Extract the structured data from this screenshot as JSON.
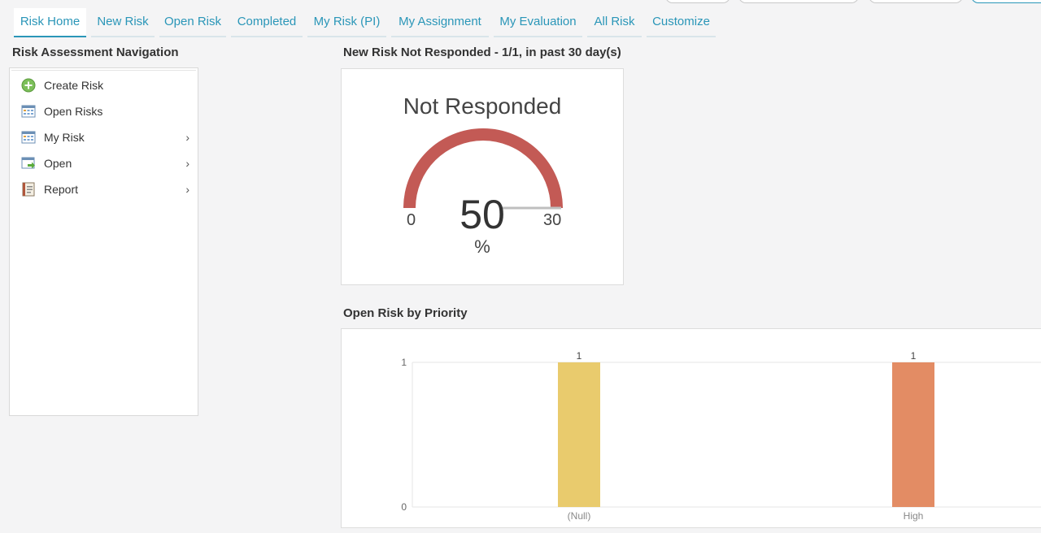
{
  "tabs": [
    {
      "label": "Risk Home",
      "active": true
    },
    {
      "label": "New Risk"
    },
    {
      "label": "Open Risk"
    },
    {
      "label": "Completed"
    },
    {
      "label": "My Risk (PI)"
    },
    {
      "label": "My Assignment"
    },
    {
      "label": "My Evaluation"
    },
    {
      "label": "All Risk"
    },
    {
      "label": "Customize"
    }
  ],
  "sidebar": {
    "title": "Risk Assessment Navigation",
    "items": [
      {
        "label": "Create Risk",
        "icon": "plus-circle-icon"
      },
      {
        "label": "Open Risks",
        "icon": "grid-table-icon"
      },
      {
        "label": "My Risk",
        "icon": "grid-table-icon",
        "submenu": true
      },
      {
        "label": "Open",
        "icon": "window-arrow-icon",
        "submenu": true
      },
      {
        "label": "Report",
        "icon": "report-book-icon",
        "submenu": true
      }
    ],
    "chevron": "›"
  },
  "gauge": {
    "panel_title": "New Risk Not Responded - 1/1, in past 30 day(s)",
    "title": "Not Responded",
    "value": "50",
    "unit": "%",
    "min": "0",
    "max": "30",
    "fill_fraction": 1.0,
    "color": "#c35a55"
  },
  "priority": {
    "panel_title": "Open Risk by Priority"
  },
  "chart_data": {
    "type": "bar",
    "categories": [
      "(Null)",
      "High"
    ],
    "values": [
      1,
      1
    ],
    "data_labels": [
      "1",
      "1"
    ],
    "colors": [
      "#e9cb6d",
      "#e38c64"
    ],
    "ylim": [
      0,
      1
    ],
    "yticks": [
      "0",
      "1"
    ],
    "grid": true
  }
}
